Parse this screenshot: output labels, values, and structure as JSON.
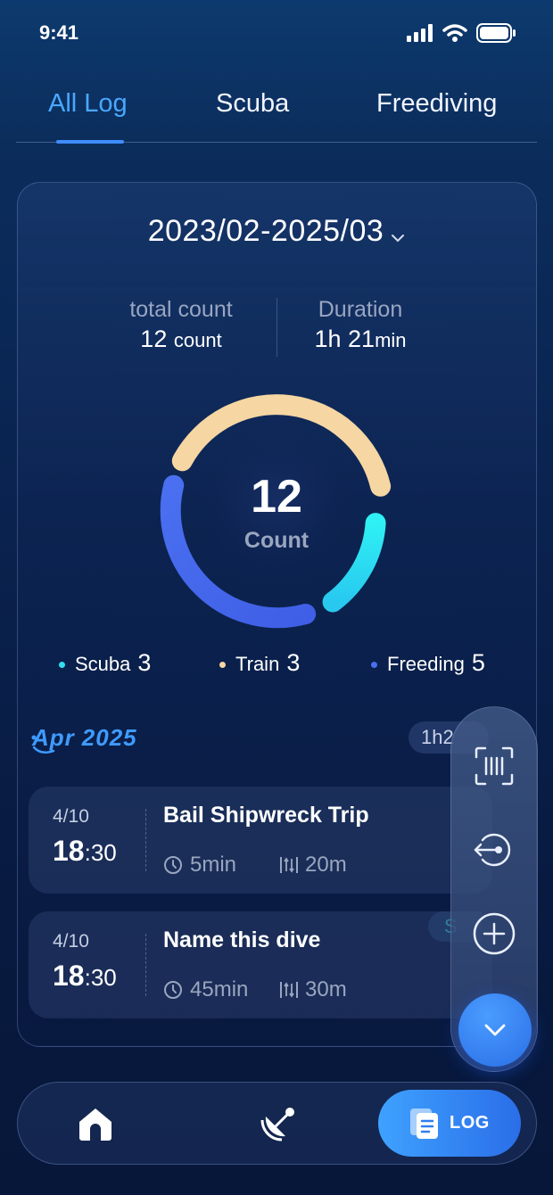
{
  "status_bar": {
    "time": "9:41"
  },
  "tabs": [
    {
      "label": "All Log",
      "active": true
    },
    {
      "label": "Scuba",
      "active": false
    },
    {
      "label": "Freediving",
      "active": false
    }
  ],
  "summary": {
    "date_range": "2023/02-2025/03",
    "total_count_label": "total count",
    "total_count_value": "12",
    "total_count_unit": "count",
    "duration_label": "Duration",
    "duration_hours": "1h 21",
    "duration_unit": "min",
    "donut_number": "12",
    "donut_caption": "Count"
  },
  "legend": [
    {
      "label": "Scuba",
      "value": "3",
      "color": "#2fe0ee"
    },
    {
      "label": "Train",
      "value": "3",
      "color": "#f6d6a2"
    },
    {
      "label": "Freeding",
      "value": "5",
      "color": "#4a6ff0"
    }
  ],
  "month_header": {
    "month": "Apr",
    "year": "2025",
    "duration_peek": "1h2"
  },
  "entries": [
    {
      "date": "4/10",
      "time_hour": "18",
      "time_min": ":30",
      "title": "Bail Shipwreck Trip",
      "duration": "5min",
      "depth": "20m"
    },
    {
      "date": "4/10",
      "time_hour": "18",
      "time_min": ":30",
      "title": "Name this dive",
      "duration": "45min",
      "depth": "30m"
    }
  ],
  "peek_badge": "S",
  "bottom_nav": {
    "log_label": "LOG"
  },
  "colors": {
    "accent": "#3f8cff",
    "scuba": "#2fe0ee",
    "train": "#f6d6a2",
    "freediving": "#4a6ff0"
  }
}
